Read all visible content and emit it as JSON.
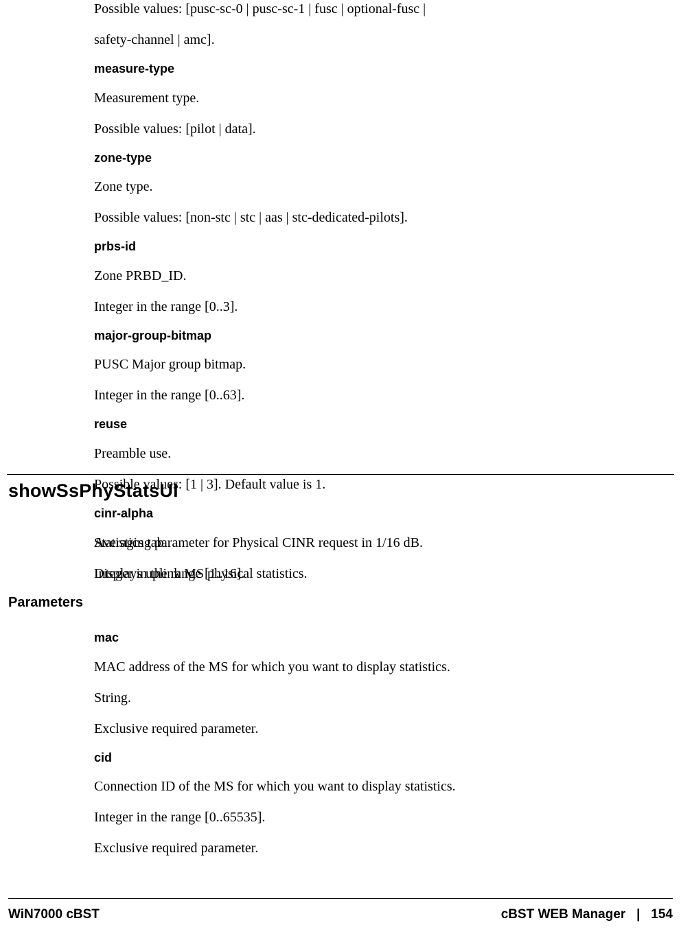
{
  "top": {
    "possible_values_line1": "Possible values: [pusc-sc-0 | pusc-sc-1 | fusc | optional-fusc |",
    "possible_values_line2": "safety-channel | amc].",
    "measure_type_label": "measure-type",
    "measure_type_desc": "Measurement type.",
    "measure_type_values": "Possible values: [pilot | data].",
    "zone_type_label": "zone-type",
    "zone_type_desc": "Zone type.",
    "zone_type_values": "Possible values: [non-stc | stc | aas | stc-dedicated-pilots].",
    "prbs_id_label": "prbs-id",
    "prbs_id_desc": "Zone PRBD_ID.",
    "prbs_id_range": "Integer in the range [0..3].",
    "major_group_bitmap_label": "major-group-bitmap",
    "major_group_bitmap_desc": "PUSC Major group bitmap.",
    "major_group_bitmap_range": "Integer in the range [0..63].",
    "reuse_label": "reuse",
    "reuse_desc": "Preamble use.",
    "reuse_values": "Possible values: [1 | 3]. Default value is 1.",
    "cinr_alpha_label": "cinr-alpha",
    "cinr_alpha_desc": "Averaging parameter for Physical CINR request in 1/16 dB.",
    "cinr_alpha_range": "Integer in the range [1..16]."
  },
  "section": {
    "title": "showSsPhyStatsUl",
    "intro1": "Statistics tab.",
    "intro2": "Displays uplink MS physical statistics.",
    "parameters_heading": "Parameters",
    "mac_label": "mac",
    "mac_desc": "MAC address of the MS for which you want to display statistics.",
    "mac_type": "String.",
    "mac_req": "Exclusive required parameter.",
    "cid_label": "cid",
    "cid_desc": "Connection ID of the MS for which you want to display statistics.",
    "cid_range": "Integer in the range [0..65535].",
    "cid_req": "Exclusive required parameter."
  },
  "footer": {
    "left": "WiN7000 cBST",
    "right": "cBST WEB Manager   |   154"
  }
}
